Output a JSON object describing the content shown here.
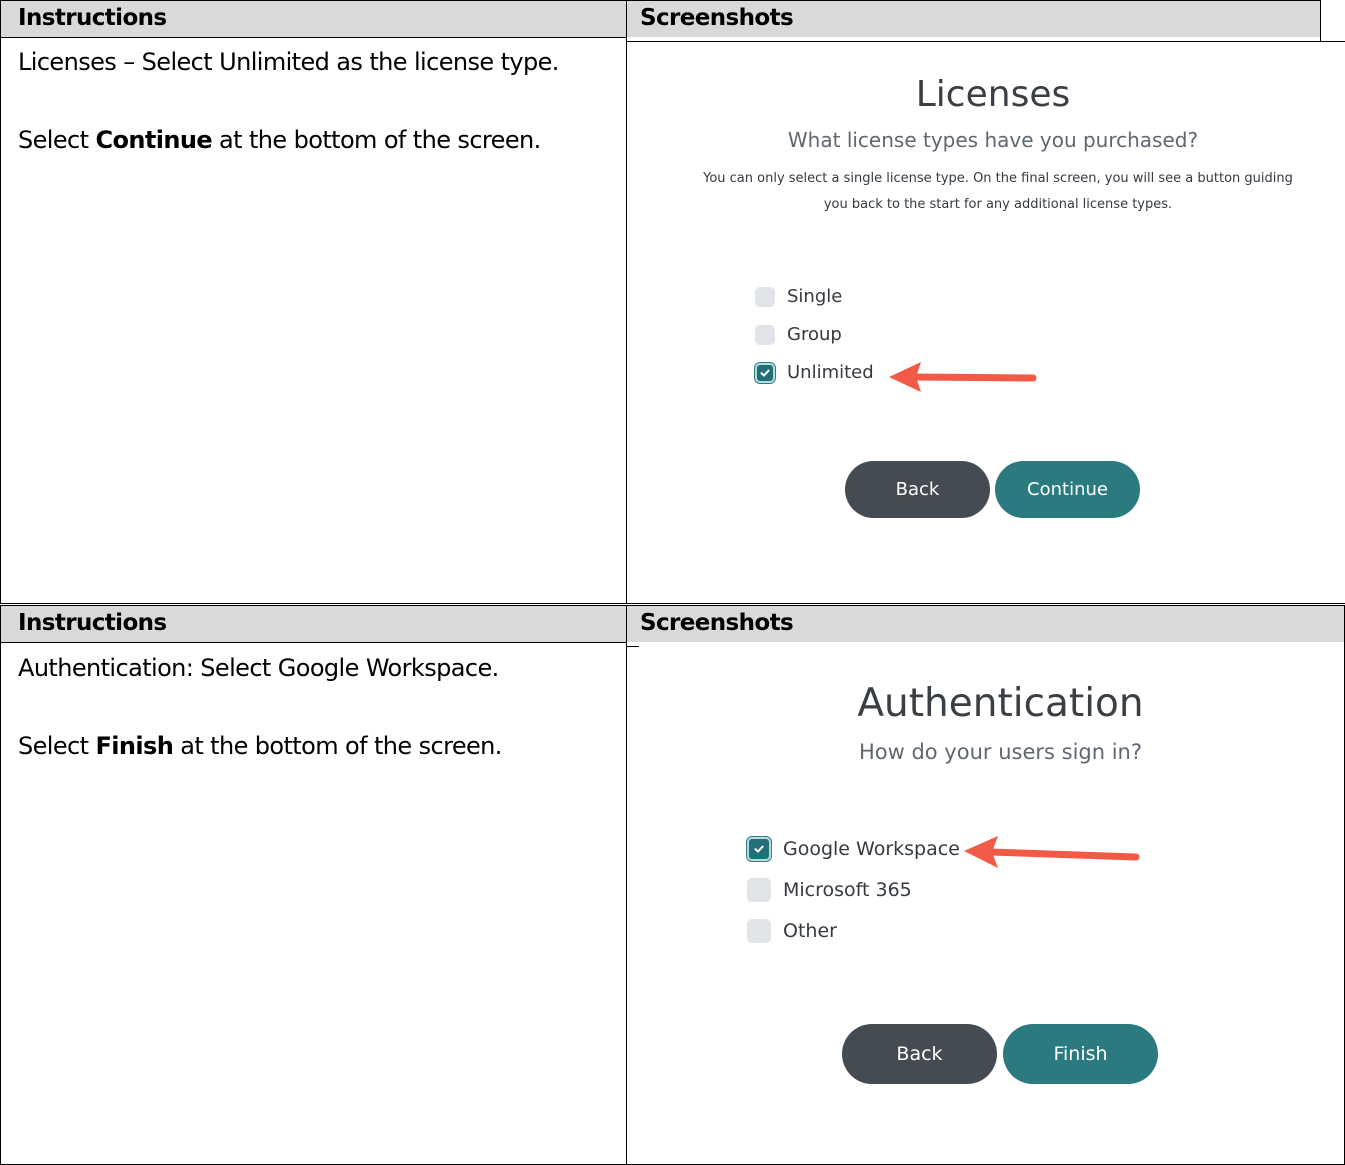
{
  "colors": {
    "header_bg": "#d9d9d9",
    "checkbox_checked": "#236f78",
    "checkbox_unchecked": "#e1e4e8",
    "back_button": "#454b52",
    "primary_button": "#2a7a7f",
    "annotation_arrow": "#f05a46"
  },
  "sections": [
    {
      "header_left": "Instructions",
      "header_right": "Screenshots",
      "instruction_line1": "Licenses – Select Unlimited as the license type.",
      "instruction_action_prefix": "Select ",
      "instruction_action_bold": "Continue",
      "instruction_action_suffix": " at the bottom of the screen.",
      "screenshot": {
        "title": "Licenses",
        "subtitle": "What license types have you purchased?",
        "description": "You can only select a single license type. On the final screen, you will see a button guiding you back to the start for any additional license types.",
        "options": [
          {
            "label": "Single",
            "checked": false
          },
          {
            "label": "Group",
            "checked": false
          },
          {
            "label": "Unlimited",
            "checked": true
          }
        ],
        "back_label": "Back",
        "primary_label": "Continue"
      }
    },
    {
      "header_left": "Instructions",
      "header_right": "Screenshots",
      "instruction_line1": "Authentication: Select Google Workspace.",
      "instruction_action_prefix": "Select ",
      "instruction_action_bold": "Finish",
      "instruction_action_suffix": " at the bottom of the screen.",
      "screenshot": {
        "title": "Authentication",
        "subtitle": "How do your users sign in?",
        "options": [
          {
            "label": "Google Workspace",
            "checked": true
          },
          {
            "label": "Microsoft 365",
            "checked": false
          },
          {
            "label": "Other",
            "checked": false
          }
        ],
        "back_label": "Back",
        "primary_label": "Finish"
      }
    }
  ]
}
